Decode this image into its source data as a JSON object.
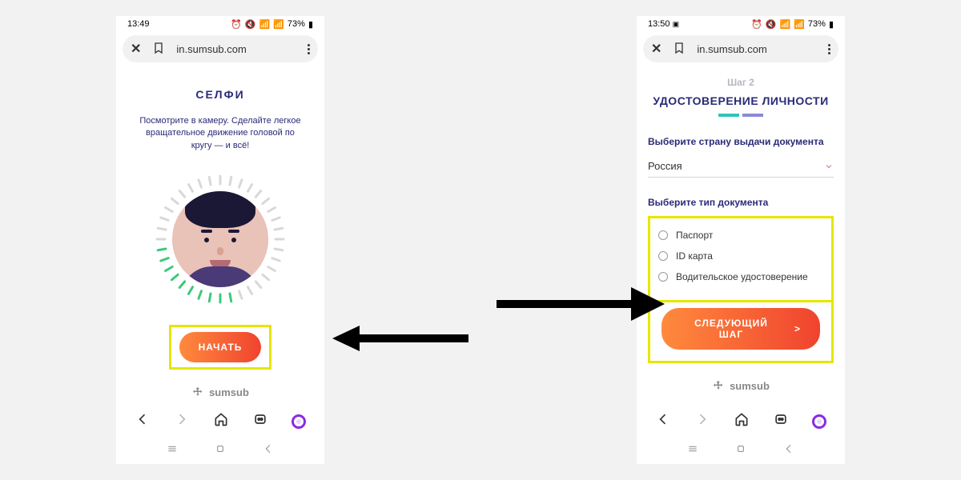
{
  "left_phone": {
    "status": {
      "time": "13:49",
      "battery": "73%"
    },
    "browser": {
      "url": "in.sumsub.com"
    },
    "selfie": {
      "title": "СЕЛФИ",
      "instructions": "Посмотрите в камеру. Сделайте легкое вращательное движение головой по кругу — и всё!",
      "start_button": "НАЧАТЬ"
    },
    "brand": "sumsub"
  },
  "right_phone": {
    "status": {
      "time": "13:50",
      "battery": "73%"
    },
    "browser": {
      "url": "in.sumsub.com"
    },
    "step_label": "Шаг 2",
    "title": "УДОСТОВЕРЕНИЕ ЛИЧНОСТИ",
    "country": {
      "label": "Выберите страну выдачи документа",
      "value": "Россия"
    },
    "doc_type": {
      "label": "Выберите тип документа",
      "options": [
        "Паспорт",
        "ID карта",
        "Водительское удостоверение"
      ]
    },
    "next_button": "СЛЕДУЮЩИЙ ШАГ",
    "next_arrow": ">",
    "brand": "sumsub"
  }
}
